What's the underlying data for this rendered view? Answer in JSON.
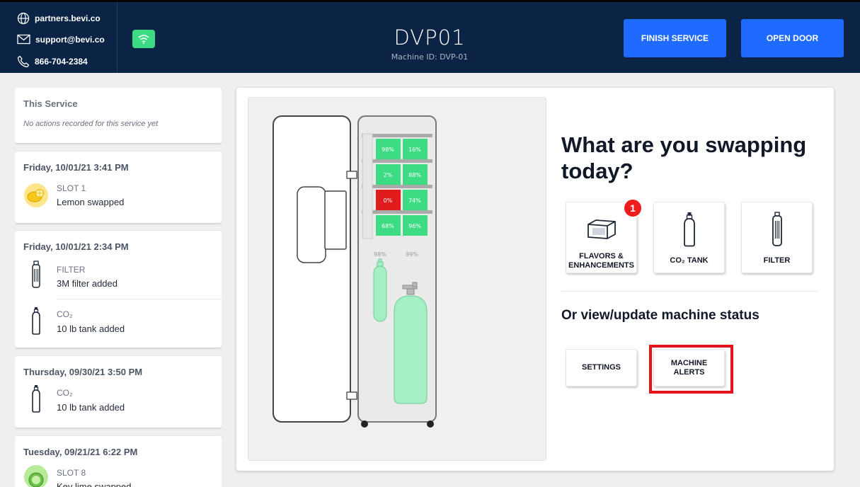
{
  "header": {
    "contacts": [
      {
        "icon": "globe-icon",
        "text": "partners.bevi.co"
      },
      {
        "icon": "envelope-icon",
        "text": "support@bevi.co"
      },
      {
        "icon": "phone-icon",
        "text": "866-704-2384"
      }
    ],
    "machine_name": "DVP01",
    "machine_id": "Machine ID: DVP-01",
    "finish_label": "FINISH SERVICE",
    "open_door_label": "OPEN DOOR"
  },
  "sidebar": {
    "this_service": {
      "title": "This Service",
      "empty_text": "No actions recorded for this service yet"
    },
    "history": [
      {
        "date": "Friday, 10/01/21 3:41 PM",
        "entries": [
          {
            "icon": "lemon-icon",
            "type": "SLOT 1",
            "desc": "Lemon swapped"
          }
        ]
      },
      {
        "date": "Friday, 10/01/21 2:34 PM",
        "entries": [
          {
            "icon": "filter-icon",
            "type": "FILTER",
            "desc": "3M filter added"
          },
          {
            "icon": "co2-tank-icon",
            "type": "CO₂",
            "desc": "10 lb tank added"
          }
        ]
      },
      {
        "date": "Thursday, 09/30/21 3:50 PM",
        "entries": [
          {
            "icon": "co2-tank-icon",
            "type": "CO₂",
            "desc": "10 lb tank added"
          }
        ]
      },
      {
        "date": "Tuesday, 09/21/21 6:22 PM",
        "entries": [
          {
            "icon": "lime-icon",
            "type": "SLOT 8",
            "desc": "Key lime swapped"
          }
        ]
      }
    ]
  },
  "diagram": {
    "slots": [
      "98%",
      "16%",
      "2%",
      "88%",
      "0%",
      "74%",
      "68%",
      "96%"
    ],
    "filter_level": "98%",
    "co2_level": "99%",
    "colors": {
      "ok": "#3ddc84",
      "empty": "#e01b1b",
      "tank": "#a6eec4"
    }
  },
  "main": {
    "swap_title": "What are you swapping today?",
    "swap_options": [
      {
        "label_line1": "FLAVORS &",
        "label_line2": "ENHANCEMENTS",
        "icon": "flavor-box-icon",
        "badge": "1"
      },
      {
        "label": "CO₂ TANK",
        "icon": "co2-tank-icon"
      },
      {
        "label": "FILTER",
        "icon": "filter-icon"
      }
    ],
    "status_title": "Or view/update machine status",
    "settings_label": "SETTINGS",
    "alerts_line1": "MACHINE",
    "alerts_line2": "ALERTS"
  },
  "colors": {
    "header_bg": "#0b2344",
    "primary_button": "#1f6bff",
    "wifi": "#3ddc84",
    "alert_red": "#e3131b"
  }
}
